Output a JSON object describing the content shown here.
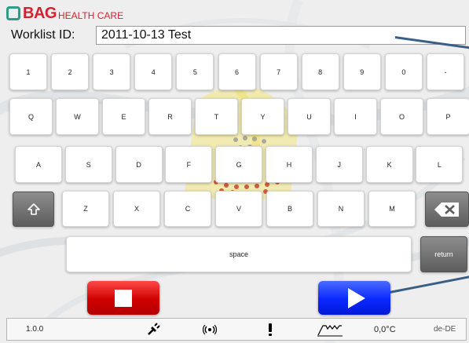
{
  "header": {
    "logo_main": "BAG",
    "logo_sub": "HEALTH CARE",
    "brand_color": "#d6202f",
    "logo_mark_color": "#2e9c86"
  },
  "worklist": {
    "label": "Worklist ID:",
    "value": "2011-10-13 Test"
  },
  "keyboard": {
    "row1": [
      "1",
      "2",
      "3",
      "4",
      "5",
      "6",
      "7",
      "8",
      "9",
      "0",
      "-"
    ],
    "row2": [
      "Q",
      "W",
      "E",
      "R",
      "T",
      "Y",
      "U",
      "I",
      "O",
      "P"
    ],
    "row3": [
      "A",
      "S",
      "D",
      "F",
      "G",
      "H",
      "J",
      "K",
      "L"
    ],
    "row4": [
      "Z",
      "X",
      "C",
      "V",
      "B",
      "N",
      "M"
    ],
    "shift_icon": "shift-arrow-icon",
    "backspace_icon": "backspace-icon",
    "space_label": "space",
    "return_label": "return"
  },
  "actions": {
    "stop_color": "#e00000",
    "start_color": "#1030ff",
    "stop_icon": "stop-square-icon",
    "start_icon": "play-icon"
  },
  "statusbar": {
    "version": "1.0.0",
    "icons": [
      "plug-icon",
      "radio-signal-icon",
      "warning-exclamation-icon",
      "heating-profile-icon"
    ],
    "temperature": "0,0°C",
    "locale": "de-DE"
  }
}
